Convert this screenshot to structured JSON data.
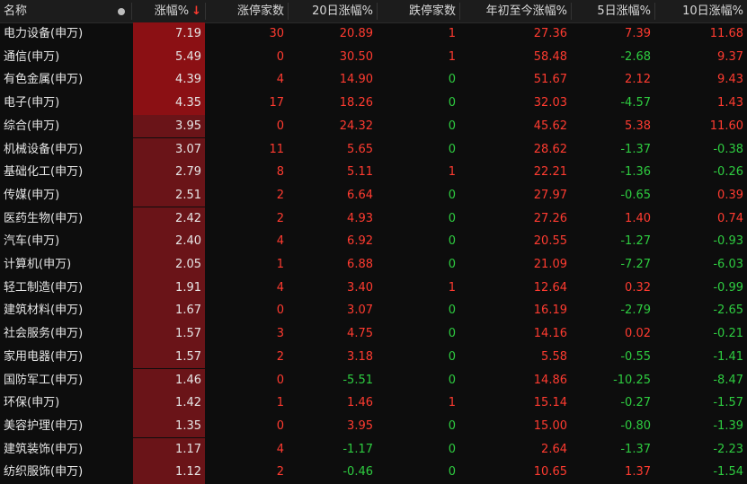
{
  "header": {
    "name": "名称",
    "chg": "涨幅%",
    "limup": "涨停家数",
    "d20": "20日涨幅%",
    "limdn": "跌停家数",
    "ytd": "年初至今涨幅%",
    "d5": "5日涨幅%",
    "d10": "10日涨幅%",
    "sort_icon": "↓"
  },
  "colors": {
    "up": "#ff3b30",
    "down": "#2ecc40",
    "chg_bg_strong": "#8b1014",
    "chg_bg_weak": "#6a1418"
  },
  "rows": [
    {
      "name": "电力设备(申万)",
      "chg": "7.19",
      "limup": "30",
      "d20": "20.89",
      "limdn": "1",
      "ytd": "27.36",
      "d5": "7.39",
      "d10": "11.68"
    },
    {
      "name": "通信(申万)",
      "chg": "5.49",
      "limup": "0",
      "d20": "30.50",
      "limdn": "1",
      "ytd": "58.48",
      "d5": "-2.68",
      "d10": "9.37"
    },
    {
      "name": "有色金属(申万)",
      "chg": "4.39",
      "limup": "4",
      "d20": "14.90",
      "limdn": "0",
      "ytd": "51.67",
      "d5": "2.12",
      "d10": "9.43"
    },
    {
      "name": "电子(申万)",
      "chg": "4.35",
      "limup": "17",
      "d20": "18.26",
      "limdn": "0",
      "ytd": "32.03",
      "d5": "-4.57",
      "d10": "1.43"
    },
    {
      "name": "综合(申万)",
      "chg": "3.95",
      "limup": "0",
      "d20": "24.32",
      "limdn": "0",
      "ytd": "45.62",
      "d5": "5.38",
      "d10": "11.60"
    },
    {
      "name": "机械设备(申万)",
      "chg": "3.07",
      "limup": "11",
      "d20": "5.65",
      "limdn": "0",
      "ytd": "28.62",
      "d5": "-1.37",
      "d10": "-0.38"
    },
    {
      "name": "基础化工(申万)",
      "chg": "2.79",
      "limup": "8",
      "d20": "5.11",
      "limdn": "1",
      "ytd": "22.21",
      "d5": "-1.36",
      "d10": "-0.26"
    },
    {
      "name": "传媒(申万)",
      "chg": "2.51",
      "limup": "2",
      "d20": "6.64",
      "limdn": "0",
      "ytd": "27.97",
      "d5": "-0.65",
      "d10": "0.39"
    },
    {
      "name": "医药生物(申万)",
      "chg": "2.42",
      "limup": "2",
      "d20": "4.93",
      "limdn": "0",
      "ytd": "27.26",
      "d5": "1.40",
      "d10": "0.74"
    },
    {
      "name": "汽车(申万)",
      "chg": "2.40",
      "limup": "4",
      "d20": "6.92",
      "limdn": "0",
      "ytd": "20.55",
      "d5": "-1.27",
      "d10": "-0.93"
    },
    {
      "name": "计算机(申万)",
      "chg": "2.05",
      "limup": "1",
      "d20": "6.88",
      "limdn": "0",
      "ytd": "21.09",
      "d5": "-7.27",
      "d10": "-6.03"
    },
    {
      "name": "轻工制造(申万)",
      "chg": "1.91",
      "limup": "4",
      "d20": "3.40",
      "limdn": "1",
      "ytd": "12.64",
      "d5": "0.32",
      "d10": "-0.99"
    },
    {
      "name": "建筑材料(申万)",
      "chg": "1.67",
      "limup": "0",
      "d20": "3.07",
      "limdn": "0",
      "ytd": "16.19",
      "d5": "-2.79",
      "d10": "-2.65"
    },
    {
      "name": "社会服务(申万)",
      "chg": "1.57",
      "limup": "3",
      "d20": "4.75",
      "limdn": "0",
      "ytd": "14.16",
      "d5": "0.02",
      "d10": "-0.21"
    },
    {
      "name": "家用电器(申万)",
      "chg": "1.57",
      "limup": "2",
      "d20": "3.18",
      "limdn": "0",
      "ytd": "5.58",
      "d5": "-0.55",
      "d10": "-1.41"
    },
    {
      "name": "国防军工(申万)",
      "chg": "1.46",
      "limup": "0",
      "d20": "-5.51",
      "limdn": "0",
      "ytd": "14.86",
      "d5": "-10.25",
      "d10": "-8.47"
    },
    {
      "name": "环保(申万)",
      "chg": "1.42",
      "limup": "1",
      "d20": "1.46",
      "limdn": "1",
      "ytd": "15.14",
      "d5": "-0.27",
      "d10": "-1.57"
    },
    {
      "name": "美容护理(申万)",
      "chg": "1.35",
      "limup": "0",
      "d20": "3.95",
      "limdn": "0",
      "ytd": "15.00",
      "d5": "-0.80",
      "d10": "-1.39"
    },
    {
      "name": "建筑装饰(申万)",
      "chg": "1.17",
      "limup": "4",
      "d20": "-1.17",
      "limdn": "0",
      "ytd": "2.64",
      "d5": "-1.37",
      "d10": "-2.23"
    },
    {
      "name": "纺织服饰(申万)",
      "chg": "1.12",
      "limup": "2",
      "d20": "-0.46",
      "limdn": "0",
      "ytd": "10.65",
      "d5": "1.37",
      "d10": "-1.54"
    }
  ]
}
